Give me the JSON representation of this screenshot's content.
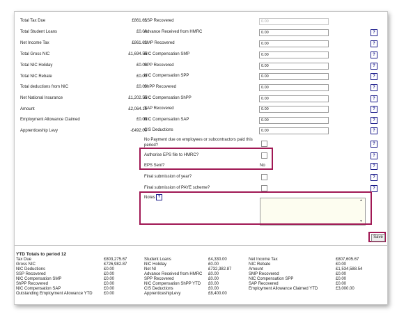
{
  "left_totals": [
    {
      "label": "Total Tax Due",
      "value": "£861.61"
    },
    {
      "label": "Total Student Loans",
      "value": "£0.00"
    },
    {
      "label": "Net Income Tax",
      "value": "£861.61"
    },
    {
      "label": "Total Gross NIC",
      "value": "£1,694.55"
    },
    {
      "label": "Total NIC Holiday",
      "value": "£0.00"
    },
    {
      "label": "Total NIC Rebate",
      "value": "£0.00"
    },
    {
      "label": "Total deductions from NIC",
      "value": "£0.00"
    },
    {
      "label": "Net National Insurance",
      "value": "£1,202.55"
    },
    {
      "label": "Amount",
      "value": "£2,064.16"
    },
    {
      "label": "Employment Allowance Claimed",
      "value": "£0.00"
    },
    {
      "label": "Apprenticeship Levy",
      "value": "-£492.00"
    }
  ],
  "right_fields": [
    {
      "label": "SSP Recovered",
      "value": "0.00",
      "disabled": true,
      "help": false
    },
    {
      "label": "Advance Received from HMRC",
      "value": "0.00",
      "help": true
    },
    {
      "label": "SMP Recovered",
      "value": "0.00",
      "help": true
    },
    {
      "label": "NIC Compensation SMP",
      "value": "0.00",
      "help": true
    },
    {
      "label": "SPP Recovered",
      "value": "0.00",
      "help": true
    },
    {
      "label": "NIC Compensation SPP",
      "value": "0.00",
      "help": true
    },
    {
      "label": "ShPP Recovered",
      "value": "0.00",
      "help": true
    },
    {
      "label": "NIC Compensation ShPP",
      "value": "0.00",
      "help": true
    },
    {
      "label": "SAP Recovered",
      "value": "0.00",
      "help": true
    },
    {
      "label": "NIC Compensation SAP",
      "value": "0.00",
      "help": true
    },
    {
      "label": "CIS Deductions",
      "value": "0.00",
      "help": true
    }
  ],
  "checks": {
    "no_payment_line1": "No Payment due on employees or subcontractors paid this",
    "no_payment_line2": "period?",
    "authorise_eps": "Authorise EPS file to HMRC?",
    "eps_sent": "EPS Sent?",
    "eps_sent_value": "No",
    "final_year": "Final submission of year?",
    "final_paye": "Final submission of PAYE scheme?"
  },
  "help_glyph": "?",
  "notes": {
    "label": "Notes",
    "value": "",
    "scroll_up": "▲",
    "scroll_down": "▼"
  },
  "save_label": "Save",
  "ytd": {
    "title": "YTD Totals to period 12",
    "col1": [
      {
        "label": "Tax Due",
        "value": "£803,275.67"
      },
      {
        "label": "Gross NIC",
        "value": "£726,982.87"
      },
      {
        "label": "NIC Deductions",
        "value": "£0.00"
      },
      {
        "label": "SSP Recovered",
        "value": "£0.00"
      },
      {
        "label": "NIC Compensation SMP",
        "value": "£0.00"
      },
      {
        "label": "ShPP Recovered",
        "value": "£0.00"
      },
      {
        "label": "NIC Compensation SAP",
        "value": "£0.00"
      },
      {
        "label": "Outstanding Employment Allowance YTD",
        "value": "£0.00"
      }
    ],
    "col2": [
      {
        "label": "Student Loans",
        "value": "£4,330.00"
      },
      {
        "label": "NIC Holiday",
        "value": "£0.00"
      },
      {
        "label": "Net NI",
        "value": "£732,382.87"
      },
      {
        "label": "Advance Received from HMRC",
        "value": "£0.00"
      },
      {
        "label": "SPP Recovered",
        "value": "£0.00"
      },
      {
        "label": "NIC Compensation ShPP YTD",
        "value": "£0.00"
      },
      {
        "label": "CIS Deductions",
        "value": "£0.00"
      },
      {
        "label": "ApprenticeshipLevy",
        "value": "£8,400.00"
      }
    ],
    "col3": [
      {
        "label": "Net Income Tax",
        "value": "£807,605.67"
      },
      {
        "label": "NIC Rebate",
        "value": "£0.00"
      },
      {
        "label": "Amount",
        "value": "£1,534,588.54"
      },
      {
        "label": "SMP Recovered",
        "value": "£0.00"
      },
      {
        "label": "NIC Compensation SPP",
        "value": "£0.00"
      },
      {
        "label": "SAP Recovered",
        "value": "£0.00"
      },
      {
        "label": "Employment Allowance Claimed YTD",
        "value": "£3,000.00"
      }
    ]
  },
  "colors": {
    "highlight": "#a01854",
    "help_border": "#1a1a8a"
  }
}
